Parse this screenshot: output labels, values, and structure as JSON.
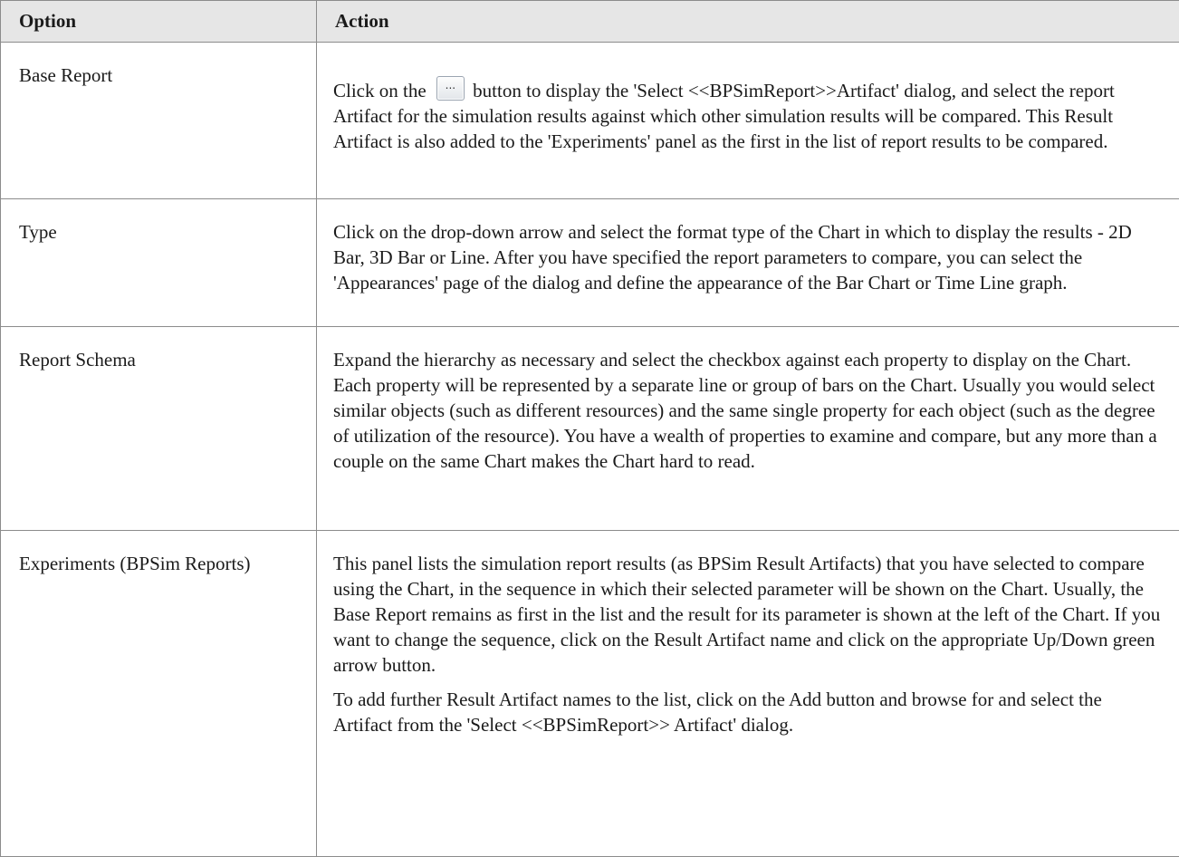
{
  "table": {
    "headers": {
      "option": "Option",
      "action": "Action"
    },
    "rows": [
      {
        "option": "Base Report",
        "action_parts": {
          "before_button": "Click on the",
          "button_label": "...",
          "after_button": "button to display the 'Select <<BPSimReport>>Artifact' dialog, and select the report Artifact for the simulation results against which other simulation results will be compared. This Result Artifact is also added to the 'Experiments' panel as the first in the list of report results to be compared."
        }
      },
      {
        "option": "Type",
        "action": "Click on the drop-down arrow and select the format type of the Chart in which to display the results - 2D Bar, 3D Bar or Line. After you have specified the report parameters to compare, you can select the 'Appearances' page of the dialog and define the appearance of the Bar Chart or Time Line graph."
      },
      {
        "option": "Report Schema",
        "action": "Expand the hierarchy as necessary and select the checkbox against each property to display on the Chart. Each property will be represented by a separate line or group of bars on the Chart. Usually you would select similar objects (such as different resources) and the same single property for each object (such as the degree of utilization of the resource). You have a wealth of properties to examine and compare, but any more than a couple on the same Chart makes the Chart hard to read."
      },
      {
        "option": "Experiments (BPSim Reports)",
        "action": "This panel lists the simulation report results (as BPSim Result Artifacts) that you have selected to compare using the Chart, in the sequence in which their selected parameter will be shown on the Chart. Usually, the Base Report remains as first in the list and the result for its parameter is shown at the left of the Chart. If you want to change the sequence, click on the Result Artifact name and click on the appropriate Up/Down green arrow button.",
        "action_note": "To add further Result Artifact names to the list, click on the Add button and browse for and select the Artifact from the 'Select <<BPSimReport>> Artifact' dialog."
      }
    ]
  }
}
